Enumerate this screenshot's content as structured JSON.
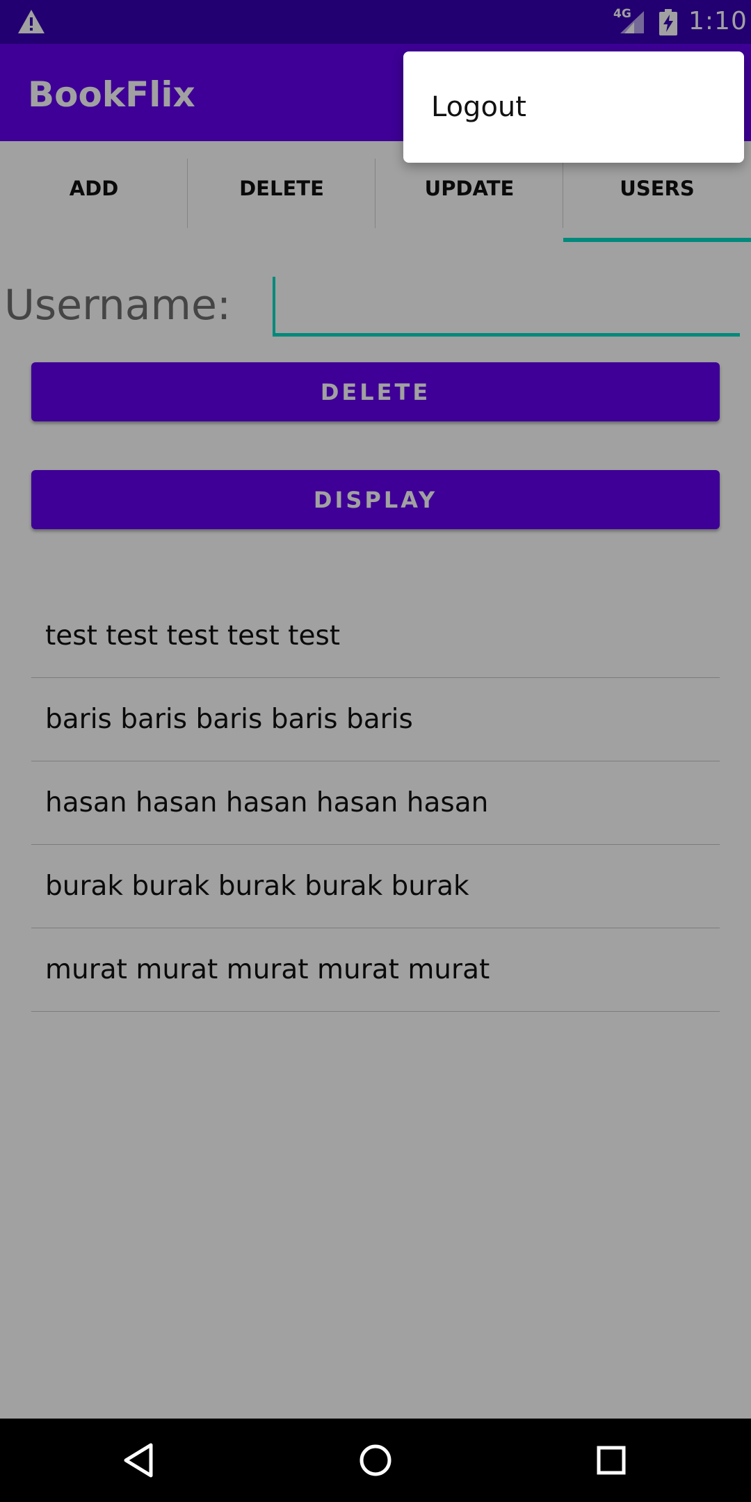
{
  "status_bar": {
    "network": "4G",
    "time": "1:10",
    "icons": [
      "warning-icon",
      "signal-icon",
      "battery-charging-icon"
    ]
  },
  "app_bar": {
    "title": "BookFlix"
  },
  "tabs": [
    {
      "label": "ADD",
      "selected": false
    },
    {
      "label": "DELETE",
      "selected": false
    },
    {
      "label": "UPDATE",
      "selected": false
    },
    {
      "label": "USERS",
      "selected": true
    }
  ],
  "form": {
    "username_label": "Username:",
    "username_value": "",
    "delete_label": "DELETE",
    "display_label": "DISPLAY"
  },
  "users": [
    "test test test test test",
    "baris baris baris baris baris",
    "hasan hasan hasan hasan hasan",
    "burak burak burak burak burak",
    "murat murat murat murat murat"
  ],
  "menu": {
    "items": [
      "Logout"
    ]
  },
  "nav_bar": {
    "icons": [
      "back-icon",
      "home-icon",
      "recents-icon"
    ]
  },
  "colors": {
    "status_bar": "#3700B3",
    "primary": "#6200EE",
    "accent": "#03DAC5",
    "nav_bar": "#000000"
  }
}
